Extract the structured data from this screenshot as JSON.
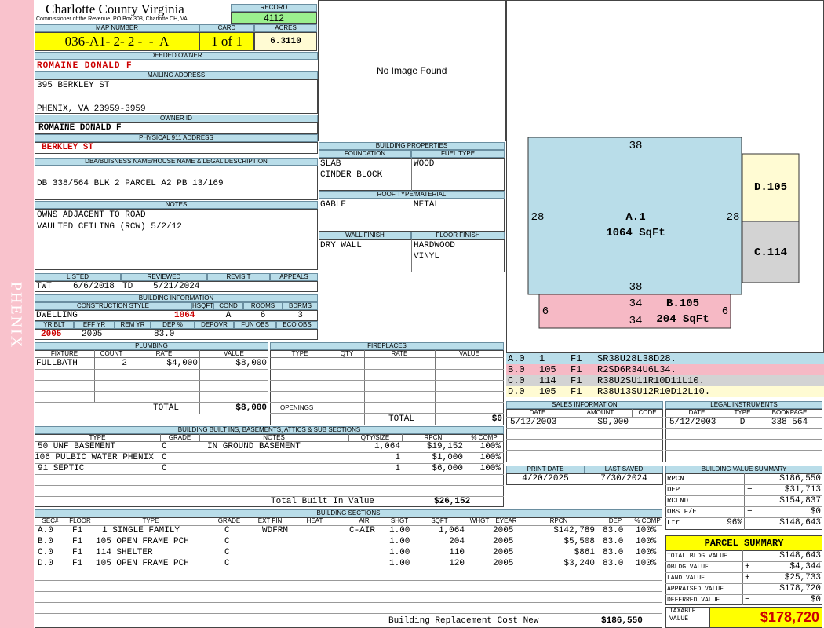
{
  "sidebar": {
    "city": "PHENIX"
  },
  "header": {
    "county": "Charlotte County Virginia",
    "office": "Commissioner of the Revenue, PO Box 308, Charlotte CH, VA",
    "record_label": "RECORD",
    "record": "4112",
    "map_label": "MAP NUMBER",
    "map": "036-A1- 2- 2 -  -  A",
    "card_label": "CARD",
    "card": "1 of 1",
    "acres_label": "ACRES",
    "acres": "6.3110"
  },
  "owner": {
    "deeded_label": "DEEDED OWNER",
    "deeded": "ROMAINE DONALD F",
    "mailing_label": "MAILING ADDRESS",
    "mail1": "395 BERKLEY ST",
    "mail2": "PHENIX, VA 23959-3959",
    "ownerid_label": "OWNER ID",
    "ownerid": "ROMAINE DONALD F",
    "phys_label": "PHYSICAL 911 ADDRESS",
    "phys": "BERKLEY ST"
  },
  "dba": {
    "label": "DBA/BUISNESS NAME/HOUSE NAME & LEGAL DESCRIPTION",
    "text": "DB 338/564 BLK 2 PARCEL A2 PB 13/169"
  },
  "notes": {
    "label": "NOTES",
    "line1": "OWNS ADJACENT TO ROAD",
    "line2": "VAULTED CEILING (RCW) 5/2/12"
  },
  "image": {
    "text": "No Image Found"
  },
  "bldgprops": {
    "label": "BUILDING PROPERTIES",
    "foundation_label": "FOUNDATION",
    "foundation1": "SLAB",
    "foundation2": "CINDER BLOCK",
    "fuel_label": "FUEL TYPE",
    "fuel": "WOOD",
    "roof_label": "ROOF TYPE/MATERIAL",
    "roof_type": "GABLE",
    "roof_mat": "METAL",
    "wall_label": "WALL FINISH",
    "wall": "DRY WALL",
    "floor_label": "FLOOR FINISH",
    "floor1": "HARDWOOD",
    "floor2": "VINYL"
  },
  "review": {
    "listed_label": "LISTED",
    "listed_by": "TWT",
    "listed": "6/6/2018",
    "reviewed_label": "REVIEWED",
    "reviewed_by": "TD",
    "reviewed": "5/21/2024",
    "revisit_label": "REVISIT",
    "appeals_label": "APPEALS"
  },
  "bldginfo": {
    "label": "BUILDING INFORMATION",
    "style_label": "CONSTRUCTION STYLE",
    "style": "DWELLING",
    "hsqft_label": "HSQFT",
    "hsqft": "1064",
    "cond_label": "COND",
    "cond": "A",
    "rooms_label": "ROOMS",
    "rooms": "6",
    "bdrms_label": "BDRMS",
    "bdrms": "3",
    "yrblt_label": "YR BLT",
    "yrblt": "2005",
    "effyr_label": "EFF YR",
    "effyr": "2005",
    "remyr_label": "REM YR",
    "dep_label": "DEP %",
    "dep": "83.0",
    "depovr_label": "DEPOVR",
    "funobs_label": "FUN OBS",
    "ecoobs_label": "ECO OBS"
  },
  "plumbing": {
    "label": "PLUMBING",
    "headers": [
      "FIXTURE",
      "COUNT",
      "RATE",
      "VALUE"
    ],
    "rows": [
      [
        "FULLBATH",
        "2",
        "$4,000",
        "$8,000"
      ]
    ],
    "total_label": "TOTAL",
    "total": "$8,000"
  },
  "fireplaces": {
    "label": "FIREPLACES",
    "headers": [
      "TYPE",
      "QTY",
      "RATE",
      "VALUE"
    ],
    "openings_label": "OPENINGS",
    "total_label": "TOTAL",
    "total": "$0"
  },
  "builtins": {
    "label": "BUILDING BUILT INS, BASEMENTS, ATTICS & SUB SECTIONS",
    "headers": [
      "TYPE",
      "GRADE",
      "NOTES",
      "QTY/SIZE",
      "RPCN",
      "% COMP"
    ],
    "rows": [
      [
        "50 UNF BASEMENT",
        "C",
        "IN GROUND BASEMENT",
        "1,064",
        "$19,152",
        "100%"
      ],
      [
        "106 PULBIC WATER PHENIX",
        "C",
        "",
        "1",
        "$1,000",
        "100%"
      ],
      [
        "91 SEPTIC",
        "C",
        "",
        "1",
        "$6,000",
        "100%"
      ]
    ],
    "total_label": "Total Built In Value",
    "total": "$26,152"
  },
  "sketch": {
    "a_label": "A.1",
    "a_area": "1064 SqFt",
    "a_top": "38",
    "a_bottom": "38",
    "a_left": "28",
    "a_right": "28",
    "b_label": "B.105",
    "b_area": "204 SqFt",
    "b_top": "34",
    "b_bottom": "34",
    "b_left": "6",
    "b_right": "6",
    "c_label": "C.114",
    "d_label": "D.105",
    "colors": {
      "a": "#b9dde9",
      "b": "#f6b9c5",
      "c": "#d3d3d3",
      "d": "#fffbd3"
    }
  },
  "sketch_legend": [
    [
      "A.0",
      "1",
      "F1",
      "SR38U28L38D28."
    ],
    [
      "B.0",
      "105",
      "F1",
      "R2SD6R34U6L34."
    ],
    [
      "C.0",
      "114",
      "F1",
      "R38U2SU11R10D11L10."
    ],
    [
      "D.0",
      "105",
      "F1",
      "R38U13SU12R10D12L10."
    ]
  ],
  "sales": {
    "label": "SALES INFORMATION",
    "headers": [
      "DATE",
      "AMOUNT",
      "CODE"
    ],
    "rows": [
      [
        "5/12/2003",
        "$9,000",
        ""
      ]
    ]
  },
  "legal": {
    "label": "LEGAL INSTRUMENTS",
    "headers": [
      "DATE",
      "TYPE",
      "BOOKPAGE"
    ],
    "rows": [
      [
        "5/12/2003",
        "D",
        "338 564"
      ]
    ]
  },
  "dates": {
    "print_label": "PRINT DATE",
    "print": "4/20/2025",
    "saved_label": "LAST SAVED",
    "saved": "7/30/2024"
  },
  "bvs": {
    "label": "BUILDING VALUE SUMMARY",
    "rows": [
      [
        "RPCN",
        "",
        "",
        "$186,550"
      ],
      [
        "DEP",
        "",
        "−",
        "$31,713"
      ],
      [
        "RCLND",
        "",
        "",
        "$154,837"
      ],
      [
        "OBS F/E",
        "",
        "−",
        "$0"
      ],
      [
        "Ltr",
        "96%",
        "",
        "$148,643"
      ]
    ]
  },
  "sections": {
    "label": "BUILDING SECTIONS",
    "headers": [
      "SEC#",
      "FLOOR",
      "TYPE",
      "GRADE",
      "EXT FIN",
      "HEAT",
      "AIR",
      "SHGT",
      "SQFT",
      "WHGT",
      "EYEAR",
      "RPCN",
      "DEP",
      "% COMP"
    ],
    "rows": [
      [
        "A.0",
        "F1",
        "1 SINGLE FAMILY",
        "C",
        "WDFRM",
        "",
        "C-AIR",
        "1.00",
        "1,064",
        "",
        "2005",
        "$142,789",
        "83.0",
        "100%"
      ],
      [
        "B.0",
        "F1",
        "105 OPEN FRAME PCH",
        "C",
        "",
        "",
        "",
        "1.00",
        "204",
        "",
        "2005",
        "$5,508",
        "83.0",
        "100%"
      ],
      [
        "C.0",
        "F1",
        "114 SHELTER",
        "C",
        "",
        "",
        "",
        "1.00",
        "110",
        "",
        "2005",
        "$861",
        "83.0",
        "100%"
      ],
      [
        "D.0",
        "F1",
        "105 OPEN FRAME PCH",
        "C",
        "",
        "",
        "",
        "1.00",
        "120",
        "",
        "2005",
        "$3,240",
        "83.0",
        "100%"
      ]
    ],
    "replacement_label": "Building Replacement Cost New",
    "replacement": "$186,550"
  },
  "parcel": {
    "label": "PARCEL SUMMARY",
    "rows": [
      [
        "TOTAL BLDG VALUE",
        "",
        "$148,643"
      ],
      [
        "OBLDG VALUE",
        "+",
        "$4,344"
      ],
      [
        "LAND VALUE",
        "+",
        "$25,733"
      ],
      [
        "APPRAISED VALUE",
        "",
        "$178,720"
      ],
      [
        "DEFERRED VALUE",
        "−",
        "$0"
      ]
    ],
    "taxable_label": "TAXABLE VALUE",
    "taxable": "$178,720"
  }
}
